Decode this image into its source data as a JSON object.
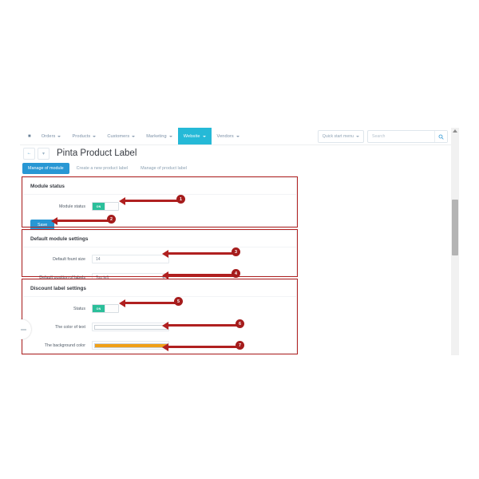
{
  "nav": {
    "items": [
      {
        "label": "",
        "icon": "home-icon",
        "caret": false,
        "active": false
      },
      {
        "label": "Orders",
        "caret": true,
        "active": false
      },
      {
        "label": "Products",
        "caret": true,
        "active": false
      },
      {
        "label": "Customers",
        "caret": true,
        "active": false
      },
      {
        "label": "Marketing",
        "caret": true,
        "active": false
      },
      {
        "label": "Website",
        "caret": true,
        "active": true
      },
      {
        "label": "Vendors",
        "caret": true,
        "active": false
      }
    ],
    "quick_menu_label": "Quick start menu",
    "search_placeholder": "Search",
    "search_value": ""
  },
  "header": {
    "back_glyph": "←",
    "caret_glyph": "▾",
    "title": "Pinta Product Label"
  },
  "tabs": [
    {
      "label": "Manage of module",
      "active": true
    },
    {
      "label": "Create a new product label",
      "active": false
    },
    {
      "label": "Manage of product label",
      "active": false
    }
  ],
  "panels": [
    {
      "id": "module-status",
      "title": "Module status",
      "rows": [
        {
          "label": "Module status",
          "type": "toggle",
          "on_label": "ON",
          "value": "on"
        }
      ],
      "save_label": "Save"
    },
    {
      "id": "default-module-settings",
      "title": "Default module settings",
      "rows": [
        {
          "label": "Default fount size",
          "type": "text",
          "value": "14"
        },
        {
          "label": "Default position of labels",
          "type": "select",
          "value": "Top left"
        }
      ]
    },
    {
      "id": "discount-label-settings",
      "title": "Discount label settings",
      "rows": [
        {
          "label": "Status",
          "type": "toggle",
          "on_label": "ON",
          "value": "on"
        },
        {
          "label": "The color of text",
          "type": "color",
          "value": "#ffffff"
        },
        {
          "label": "The background color",
          "type": "color",
          "value": "#f0a018"
        }
      ]
    }
  ],
  "annotations": {
    "color": "#b02020",
    "markers": [
      {
        "number": "1"
      },
      {
        "number": "2"
      },
      {
        "number": "3"
      },
      {
        "number": "4"
      },
      {
        "number": "5"
      },
      {
        "number": "6"
      },
      {
        "number": "7"
      }
    ]
  }
}
